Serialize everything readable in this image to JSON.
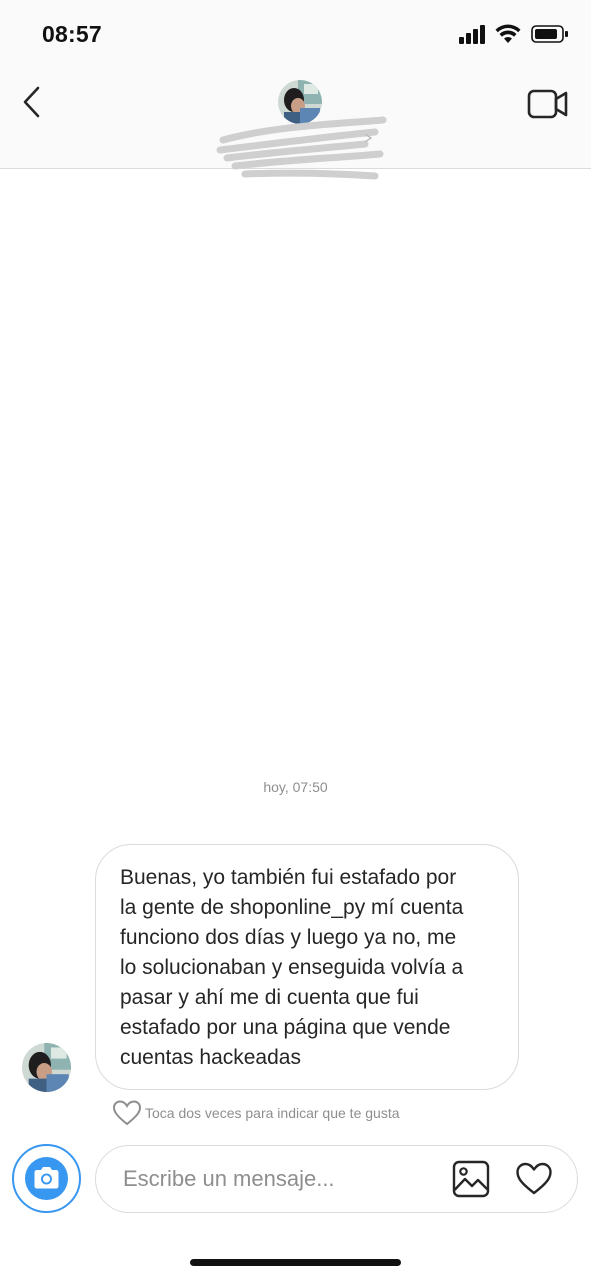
{
  "status_bar": {
    "time": "08:57"
  },
  "header": {},
  "conversation": {
    "date_label": "hoy, 07:50",
    "messages": [
      {
        "lines": [
          "Buenas, yo también fui estafado por",
          "la gente de shoponline_py mí cuenta",
          "funciono dos días y luego ya no, me",
          "lo solucionaban y enseguida volvía a",
          "pasar y ahí me di cuenta que fui",
          "estafado por una página que vende",
          "cuentas hackeadas"
        ]
      }
    ],
    "like_hint": "Toca dos veces para indicar que te gusta"
  },
  "composer": {
    "placeholder": "Escribe un mensaje..."
  },
  "colors": {
    "accent": "#3897f0",
    "border": "#dbdbdb",
    "muted_text": "#8e8e8e"
  },
  "icons": [
    "back-chevron-icon",
    "video-call-icon",
    "heart-icon",
    "camera-icon",
    "gallery-icon",
    "signal-icon",
    "wifi-icon",
    "battery-icon"
  ]
}
